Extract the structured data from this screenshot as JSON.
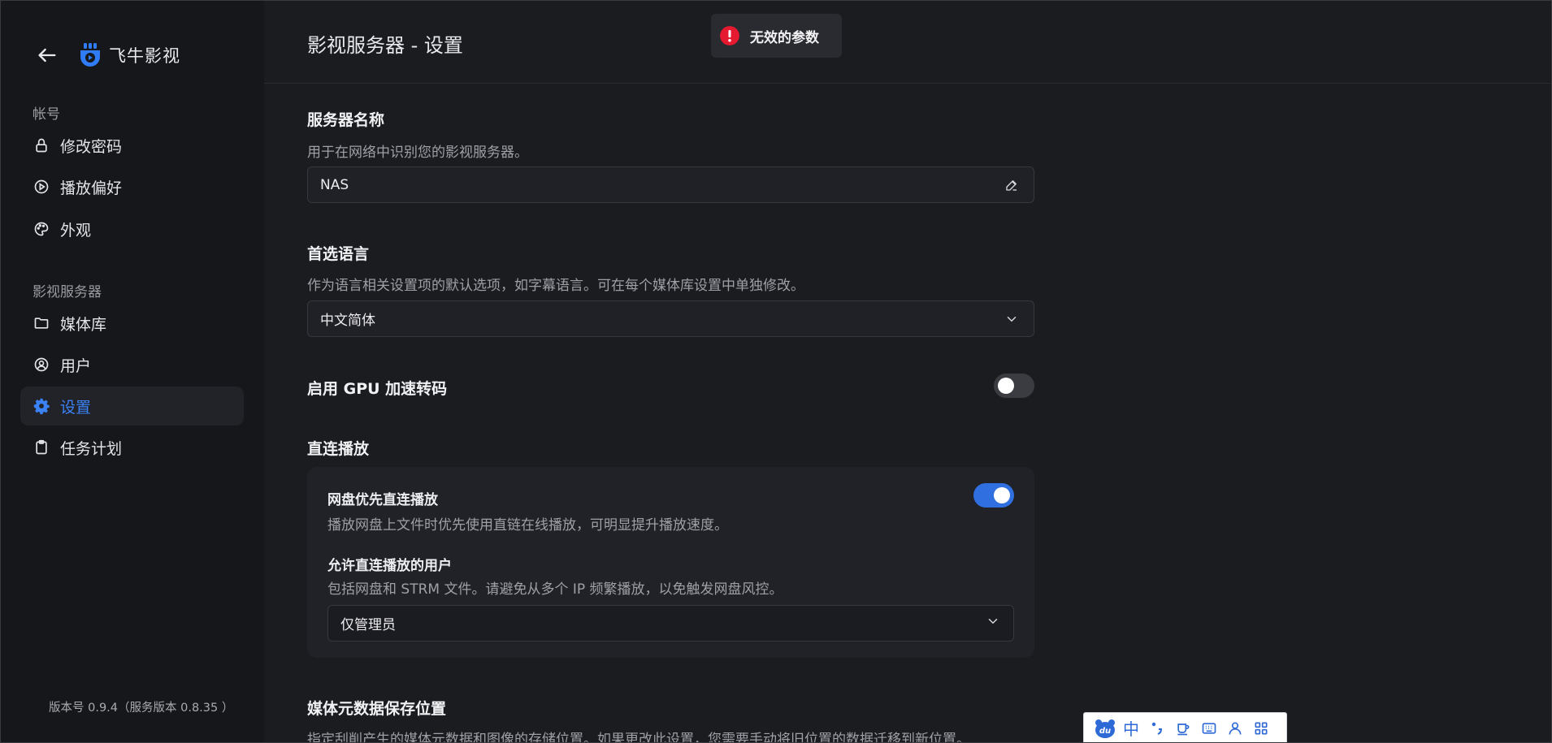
{
  "app": {
    "name": "飞牛影视"
  },
  "sidebar": {
    "account_label": "帐号",
    "account_items": [
      {
        "label": "修改密码",
        "icon": "lock-icon"
      },
      {
        "label": "播放偏好",
        "icon": "play-circle-icon"
      },
      {
        "label": "外观",
        "icon": "palette-icon"
      }
    ],
    "server_label": "影视服务器",
    "server_items": [
      {
        "label": "媒体库",
        "icon": "folder-icon"
      },
      {
        "label": "用户",
        "icon": "user-circle-icon"
      },
      {
        "label": "设置",
        "icon": "gear-icon",
        "active": true
      },
      {
        "label": "任务计划",
        "icon": "clipboard-icon"
      }
    ],
    "version": "版本号 0.9.4（服务版本 0.8.35 ）"
  },
  "header": {
    "title": "影视服务器 - 设置"
  },
  "toast": {
    "message": "无效的参数",
    "icon": "error-icon"
  },
  "settings": {
    "server_name": {
      "title": "服务器名称",
      "description": "用于在网络中识别您的影视服务器。",
      "value": "NAS"
    },
    "language": {
      "title": "首选语言",
      "description": "作为语言相关设置项的默认选项，如字幕语言。可在每个媒体库设置中单独修改。",
      "value": "中文简体"
    },
    "gpu": {
      "title": "启用 GPU 加速转码",
      "enabled": false
    },
    "direct_play": {
      "title": "直连播放",
      "cloud_first": {
        "title": "网盘优先直连播放",
        "description": "播放网盘上文件时优先使用直链在线播放，可明显提升播放速度。",
        "enabled": true
      },
      "allowed_users": {
        "title": "允许直连播放的用户",
        "description": "包括网盘和 STRM 文件。请避免从多个 IP 频繁播放，以免触发网盘风控。",
        "value": "仅管理员"
      }
    },
    "metadata_path": {
      "title": "媒体元数据保存位置",
      "description": "指定刮削产生的媒体元数据和图像的存储位置。如果更改此设置，您需要手动将旧位置的数据迁移到新位置。"
    }
  },
  "ime": {
    "mode": "中",
    "brand": "du"
  },
  "colors": {
    "accent": "#2f6fe0",
    "active_text": "#3b82f6",
    "error": "#e5192f"
  }
}
